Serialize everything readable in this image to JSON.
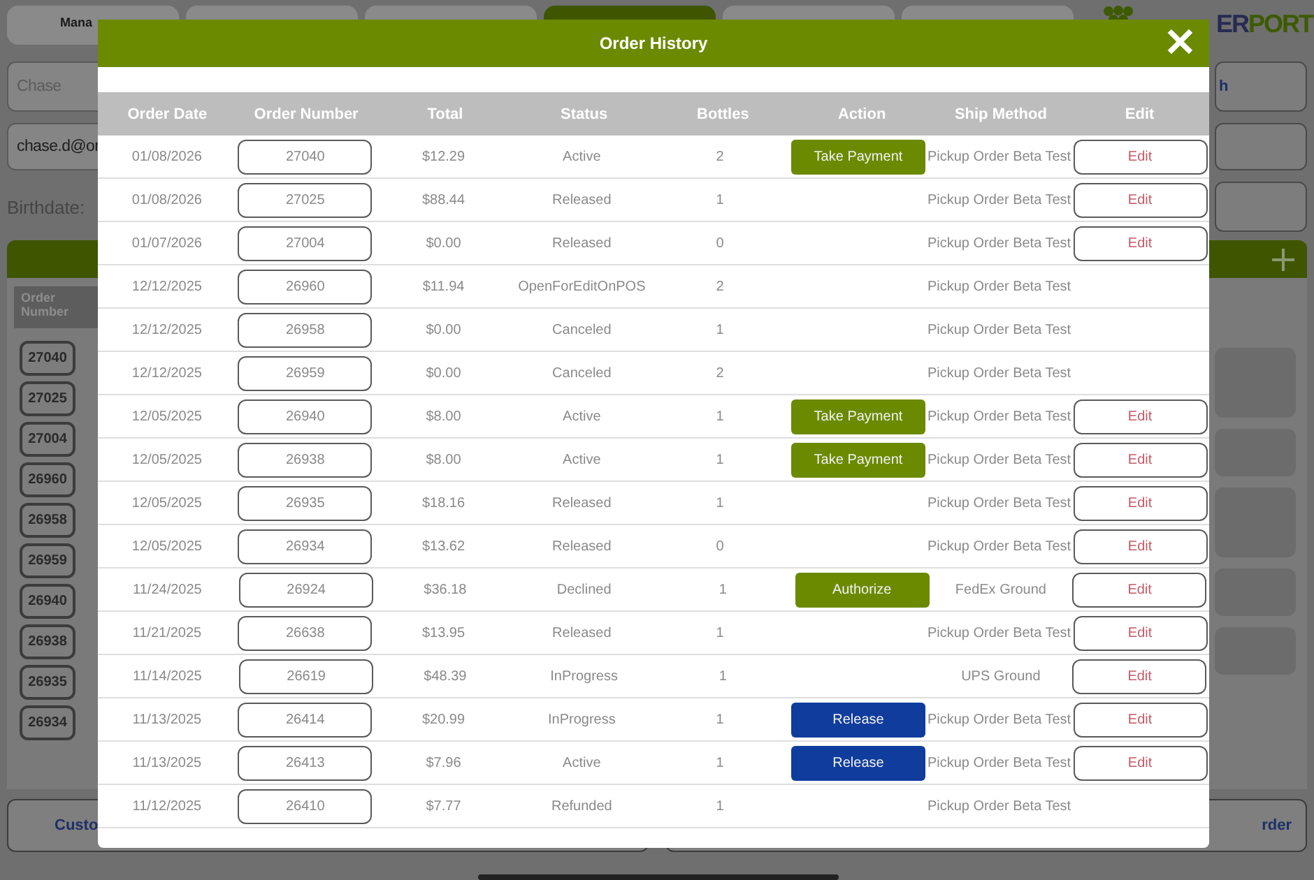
{
  "background": {
    "tabs": [
      {
        "label": "Mana",
        "selected": false
      },
      {
        "selected": false
      },
      {
        "selected": false
      },
      {
        "selected": true
      },
      {
        "selected": false
      },
      {
        "selected": false
      }
    ],
    "logo": {
      "dark_part": "ER",
      "green_part": "PORT"
    },
    "first_name": "Chase",
    "email": "chase.d@or",
    "birthdate_label": "Birthdate:",
    "side_button": "h",
    "orders_header": "Order Number",
    "order_numbers": [
      "27040",
      "27025",
      "27004",
      "26960",
      "26958",
      "26959",
      "26940",
      "26938",
      "26935",
      "26934"
    ],
    "bottom_left": "Custo",
    "bottom_right": "rder"
  },
  "modal": {
    "title": "Order History",
    "close": "✕",
    "columns": [
      "Order Date",
      "Order Number",
      "Total",
      "Status",
      "Bottles",
      "Action",
      "Ship Method",
      "Edit"
    ],
    "rows": [
      {
        "date": "01/08/2026",
        "number": "27040",
        "total": "$12.29",
        "status": "Active",
        "bottles": "2",
        "action": {
          "label": "Take Payment",
          "color": "#6b8a00"
        },
        "ship": "Pickup Order Beta Test",
        "edit": "Edit"
      },
      {
        "date": "01/08/2026",
        "number": "27025",
        "total": "$88.44",
        "status": "Released",
        "bottles": "1",
        "ship": "Pickup Order Beta Test",
        "edit": "Edit"
      },
      {
        "date": "01/07/2026",
        "number": "27004",
        "total": "$0.00",
        "status": "Released",
        "bottles": "0",
        "ship": "Pickup Order Beta Test",
        "edit": "Edit"
      },
      {
        "date": "12/12/2025",
        "number": "26960",
        "total": "$11.94",
        "status": "OpenForEditOnPOS",
        "bottles": "2",
        "ship": "Pickup Order Beta Test"
      },
      {
        "date": "12/12/2025",
        "number": "26958",
        "total": "$0.00",
        "status": "Canceled",
        "bottles": "1",
        "ship": "Pickup Order Beta Test"
      },
      {
        "date": "12/12/2025",
        "number": "26959",
        "total": "$0.00",
        "status": "Canceled",
        "bottles": "2",
        "ship": "Pickup Order Beta Test"
      },
      {
        "date": "12/05/2025",
        "number": "26940",
        "total": "$8.00",
        "status": "Active",
        "bottles": "1",
        "action": {
          "label": "Take Payment",
          "color": "#6b8a00"
        },
        "ship": "Pickup Order Beta Test",
        "edit": "Edit"
      },
      {
        "date": "12/05/2025",
        "number": "26938",
        "total": "$8.00",
        "status": "Active",
        "bottles": "1",
        "action": {
          "label": "Take Payment",
          "color": "#6b8a00"
        },
        "ship": "Pickup Order Beta Test",
        "edit": "Edit"
      },
      {
        "date": "12/05/2025",
        "number": "26935",
        "total": "$18.16",
        "status": "Released",
        "bottles": "1",
        "ship": "Pickup Order Beta Test",
        "edit": "Edit"
      },
      {
        "date": "12/05/2025",
        "number": "26934",
        "total": "$13.62",
        "status": "Released",
        "bottles": "0",
        "ship": "Pickup Order Beta Test",
        "edit": "Edit"
      },
      {
        "date": "11/24/2025",
        "number": "26924",
        "total": "$36.18",
        "status": "Declined",
        "bottles": "1",
        "action": {
          "label": "Authorize",
          "color": "#6b8a00"
        },
        "ship": "FedEx Ground",
        "edit": "Edit"
      },
      {
        "date": "11/21/2025",
        "number": "26638",
        "total": "$13.95",
        "status": "Released",
        "bottles": "1",
        "ship": "Pickup Order Beta Test",
        "edit": "Edit"
      },
      {
        "date": "11/14/2025",
        "number": "26619",
        "total": "$48.39",
        "status": "InProgress",
        "bottles": "1",
        "ship": "UPS Ground",
        "edit": "Edit"
      },
      {
        "date": "11/13/2025",
        "number": "26414",
        "total": "$20.99",
        "status": "InProgress",
        "bottles": "1",
        "action": {
          "label": "Release",
          "color": "#103c9e"
        },
        "ship": "Pickup Order Beta Test",
        "edit": "Edit"
      },
      {
        "date": "11/13/2025",
        "number": "26413",
        "total": "$7.96",
        "status": "Active",
        "bottles": "1",
        "action": {
          "label": "Release",
          "color": "#103c9e"
        },
        "ship": "Pickup Order Beta Test",
        "edit": "Edit"
      },
      {
        "date": "11/12/2025",
        "number": "26410",
        "total": "$7.77",
        "status": "Refunded",
        "bottles": "1",
        "ship": "Pickup Order Beta Test"
      }
    ]
  }
}
